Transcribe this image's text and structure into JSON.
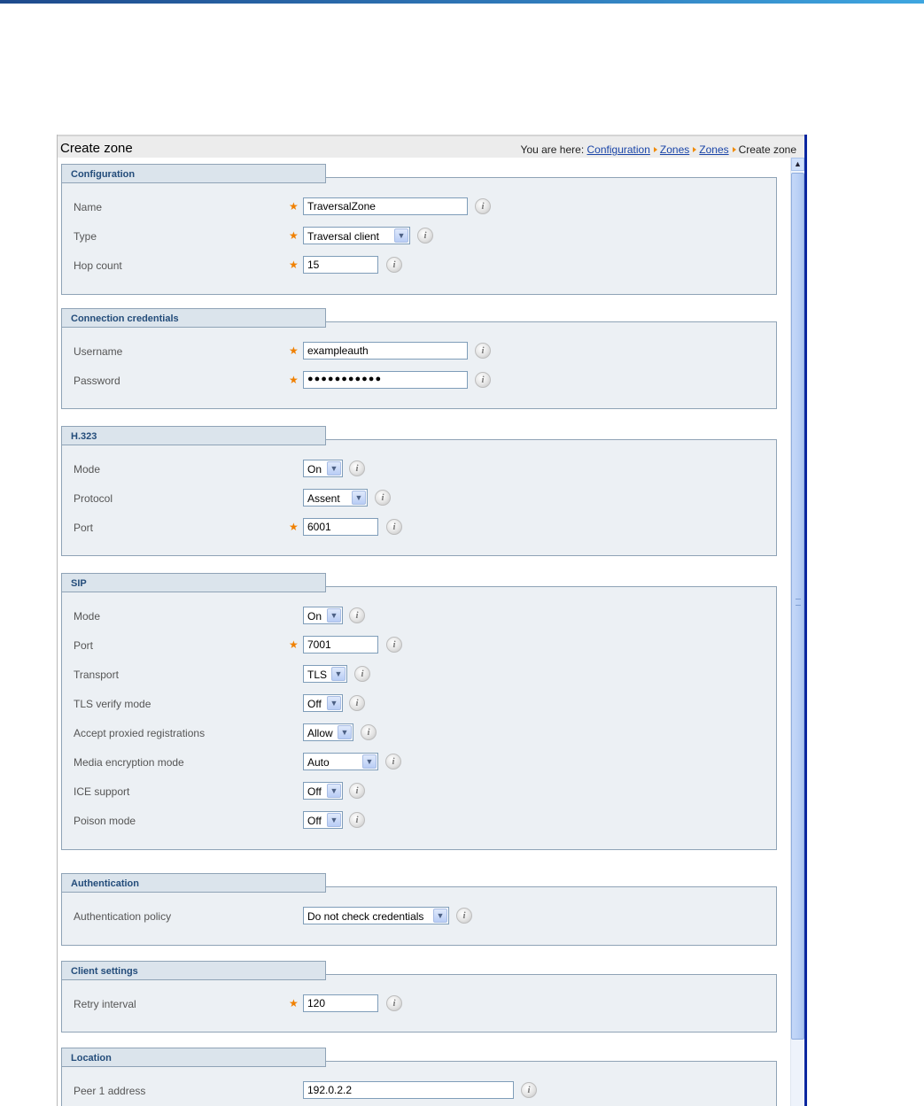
{
  "header": {
    "page_title": "Create zone",
    "breadcrumb_prefix": "You are here:",
    "crumbs": [
      "Configuration",
      "Zones",
      "Zones"
    ],
    "current": "Create zone"
  },
  "sections": {
    "configuration": {
      "title": "Configuration",
      "name_label": "Name",
      "name_value": "TraversalZone",
      "type_label": "Type",
      "type_value": "Traversal client",
      "hop_label": "Hop count",
      "hop_value": "15"
    },
    "credentials": {
      "title": "Connection credentials",
      "username_label": "Username",
      "username_value": "exampleauth",
      "password_label": "Password",
      "password_value": "●●●●●●●●●●●"
    },
    "h323": {
      "title": "H.323",
      "mode_label": "Mode",
      "mode_value": "On",
      "protocol_label": "Protocol",
      "protocol_value": "Assent",
      "port_label": "Port",
      "port_value": "6001"
    },
    "sip": {
      "title": "SIP",
      "mode_label": "Mode",
      "mode_value": "On",
      "port_label": "Port",
      "port_value": "7001",
      "transport_label": "Transport",
      "transport_value": "TLS",
      "tls_label": "TLS verify mode",
      "tls_value": "Off",
      "proxied_label": "Accept proxied registrations",
      "proxied_value": "Allow",
      "media_label": "Media encryption mode",
      "media_value": "Auto",
      "ice_label": "ICE support",
      "ice_value": "Off",
      "poison_label": "Poison mode",
      "poison_value": "Off"
    },
    "authentication": {
      "title": "Authentication",
      "policy_label": "Authentication policy",
      "policy_value": "Do not check credentials"
    },
    "client": {
      "title": "Client settings",
      "retry_label": "Retry interval",
      "retry_value": "120"
    },
    "location": {
      "title": "Location",
      "peer1_label": "Peer 1 address",
      "peer1_value": "192.0.2.2"
    }
  },
  "icons": {
    "info": "i",
    "required": "★",
    "dropdown": "▼",
    "scroll_up": "▲",
    "breadcrumb_separator": "triangle-right-icon"
  },
  "colors": {
    "required_star": "#f08000",
    "section_title": "#234c7a",
    "link": "#1a45a8"
  }
}
